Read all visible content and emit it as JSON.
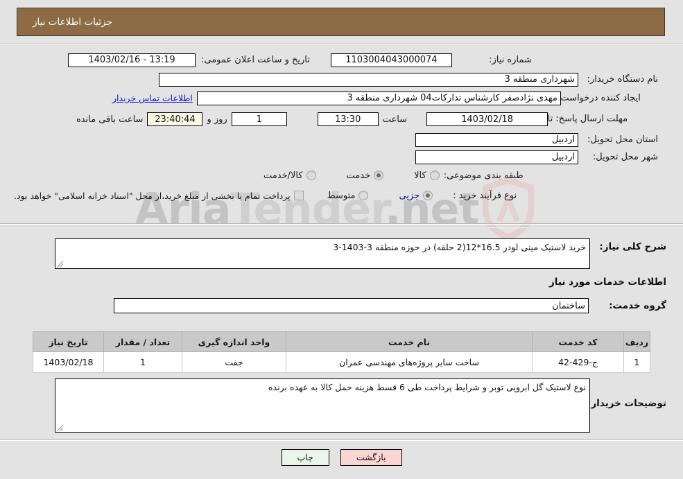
{
  "header": {
    "title": "جزئیات اطلاعات نیاز"
  },
  "watermark": {
    "text_left": "Aria",
    "text_right": "Tender",
    "text_tld": ".net"
  },
  "form": {
    "need_number_label": "شماره نیاز:",
    "need_number_value": "1103004043000074",
    "announce_label": "تاریخ و ساعت اعلان عمومی:",
    "announce_value": "13:19 - 1403/02/16",
    "buyer_org_label": "نام دستگاه خریدار:",
    "buyer_org_value": "شهرداری منطقه 3",
    "creator_label": "ایجاد کننده درخواست:",
    "creator_value": "مهدی نژادصفر کارشناس تدارکات04 شهرداری منطقه 3",
    "contact_link": "اطلاعات تماس خریدار",
    "deadline_label": "مهلت ارسال پاسخ: تا تاریخ:",
    "deadline_date": "1403/02/18",
    "hour_label": "ساعت",
    "deadline_time": "13:30",
    "days_value": "1",
    "days_label": "روز و",
    "countdown_value": "23:40:44",
    "remaining_label": "ساعت باقی مانده",
    "province_label": "استان محل تحویل:",
    "province_value": "اردبیل",
    "city_label": "شهر محل تحویل:",
    "city_value": "اردبیل",
    "category_label": "طبقه بندی موضوعی:",
    "category_options": [
      {
        "label": "کالا",
        "selected": false
      },
      {
        "label": "خدمت",
        "selected": true
      },
      {
        "label": "کالا/خدمت",
        "selected": false
      }
    ],
    "process_label": "نوع فرآیند خرید :",
    "process_options": [
      {
        "label": "جزیی",
        "selected": true
      },
      {
        "label": "متوسط",
        "selected": false
      }
    ],
    "treasury_checkbox_label": "پرداخت تمام یا بخشی از مبلغ خرید،از محل \"اسناد خزانه اسلامی\" خواهد بود.",
    "treasury_checked": false
  },
  "summary": {
    "label": "شرح کلی نیاز:",
    "value": "خرید لاستیک مینی لودر 16.5*12(2 حلقه) در حوزه منطقه 3-1403-3"
  },
  "services": {
    "section_title": "اطلاعات خدمات مورد نیاز",
    "group_label": "گروه خدمت:",
    "group_value": "ساختمان",
    "columns": [
      "ردیف",
      "کد خدمت",
      "نام خدمت",
      "واحد اندازه گیری",
      "تعداد / مقدار",
      "تاریخ نیاز"
    ],
    "rows": [
      [
        "1",
        "ج-429-42",
        "ساخت سایر پروژه‌های مهندسی عمران",
        "جفت",
        "1",
        "1403/02/18"
      ]
    ]
  },
  "notes": {
    "label": "توضیحات خریدار:",
    "value": "نوع لاستیک گل ابرویی توبر و شرایط پرداخت طی 6 قسط هزینه حمل کالا به عهده برنده"
  },
  "buttons": {
    "print": "چاپ",
    "back": "بازگشت"
  }
}
